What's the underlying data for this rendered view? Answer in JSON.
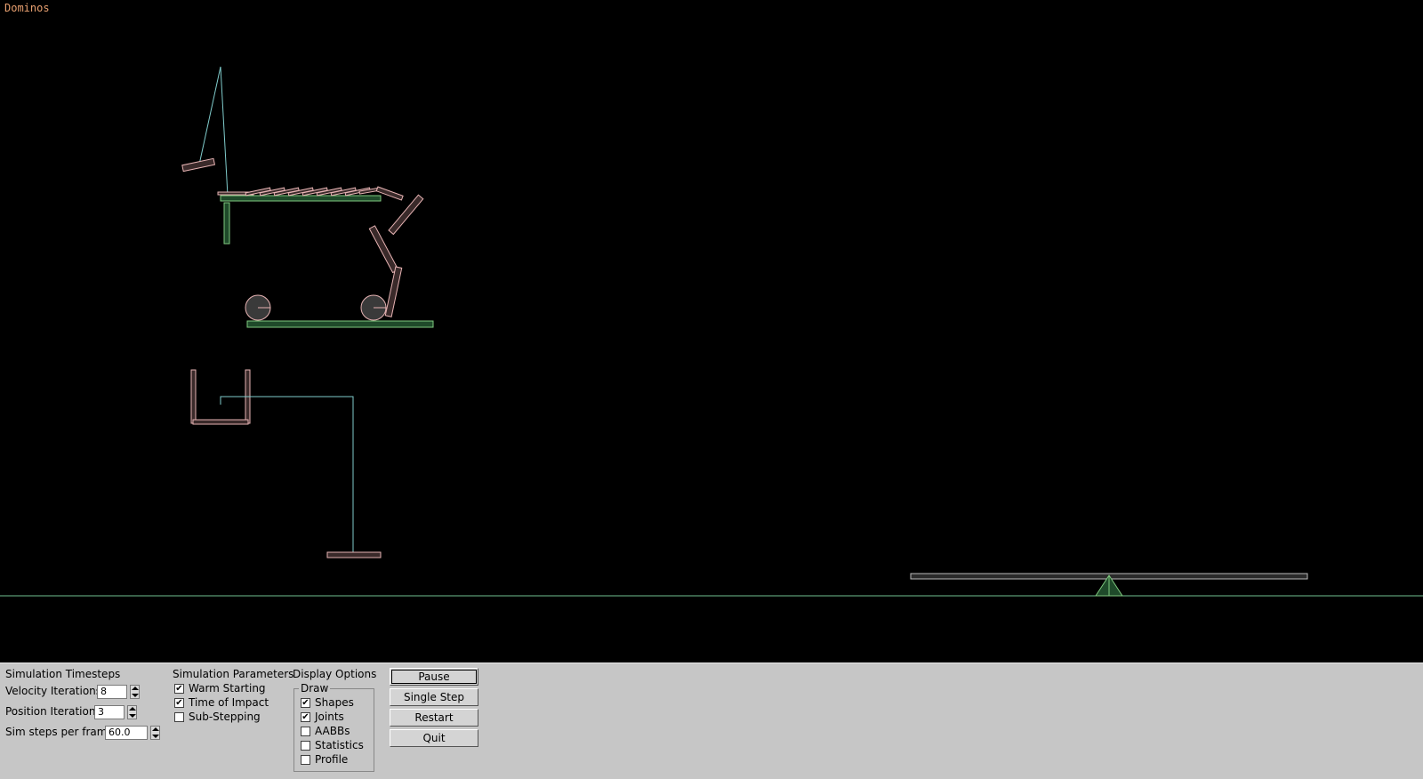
{
  "scene": {
    "title": "Dominos"
  },
  "panel": {
    "timesteps": {
      "title": "Simulation Timesteps",
      "velocity_label": "Velocity Iterations",
      "velocity_value": "8",
      "position_label": "Position Iterations",
      "position_value": "3",
      "steps_label": "Sim steps per frame",
      "steps_value": "60.0"
    },
    "parameters": {
      "title": "Simulation Parameters",
      "options": [
        {
          "label": "Warm Starting",
          "checked": true
        },
        {
          "label": "Time of Impact",
          "checked": true
        },
        {
          "label": "Sub-Stepping",
          "checked": false
        }
      ]
    },
    "display": {
      "title": "Display Options",
      "draw_label": "Draw",
      "options": [
        {
          "label": "Shapes",
          "checked": true
        },
        {
          "label": "Joints",
          "checked": true
        },
        {
          "label": "AABBs",
          "checked": false
        },
        {
          "label": "Statistics",
          "checked": false
        },
        {
          "label": "Profile",
          "checked": false
        }
      ]
    },
    "buttons": {
      "pause": "Pause",
      "single_step": "Single Step",
      "restart": "Restart",
      "quit": "Quit"
    }
  },
  "colors": {
    "background": "#000000",
    "static_body": "#7fc97f",
    "dynamic_body": "#e6b3b3",
    "joint": "#80cccc",
    "panel": "#c6c6c6"
  }
}
